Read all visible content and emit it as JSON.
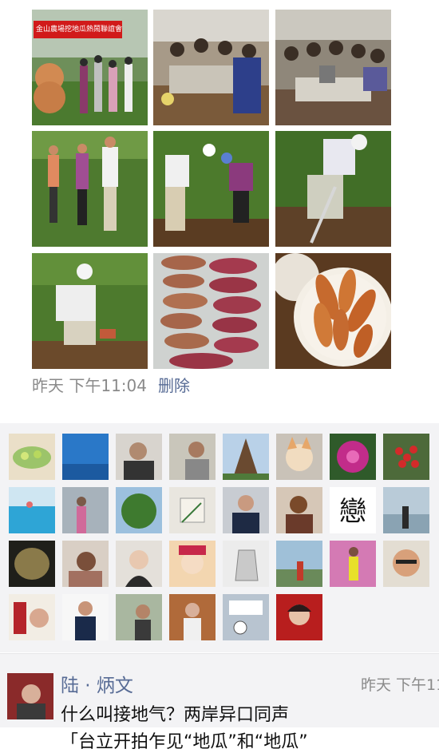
{
  "post": {
    "photos": [
      {
        "name": "photo-banner-group",
        "banner": "金山農場挖地瓜熱鬧聯誼會"
      },
      {
        "name": "photo-dinner-table-1"
      },
      {
        "name": "photo-dinner-table-2"
      },
      {
        "name": "photo-field-group"
      },
      {
        "name": "photo-digging-pair"
      },
      {
        "name": "photo-digging-man"
      },
      {
        "name": "photo-crouching-man"
      },
      {
        "name": "photo-sweet-potatoes-sack"
      },
      {
        "name": "photo-roasted-sweet-potatoes"
      }
    ],
    "time": "昨天 下午11:04",
    "delete_label": "删除"
  },
  "comment": {
    "author": "陆 · 炳文",
    "time": "昨天 下午11",
    "text": "什么叫接地气？两岸异口同声",
    "text2": "「台立开拍乍见“地瓜”和“地瓜”"
  },
  "liker_avatar_count": 31,
  "colors": {
    "link": "#576b95",
    "likes_bg": "#f3f3f5"
  }
}
